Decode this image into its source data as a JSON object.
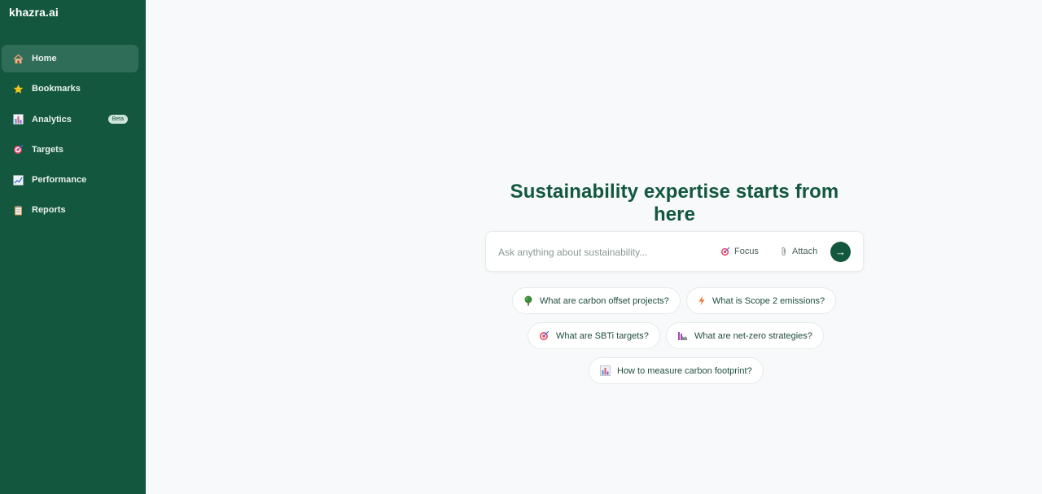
{
  "brand": "khazra.ai",
  "sidebar": {
    "items": [
      {
        "label": "Home",
        "icon": "home-icon"
      },
      {
        "label": "Bookmarks",
        "icon": "star-icon"
      },
      {
        "label": "Analytics",
        "icon": "bar-chart-icon",
        "badge": "Beta"
      },
      {
        "label": "Targets",
        "icon": "target-icon"
      },
      {
        "label": "Performance",
        "icon": "trend-chart-icon"
      },
      {
        "label": "Reports",
        "icon": "clipboard-icon"
      }
    ]
  },
  "main": {
    "headline": "Sustainability expertise starts from here",
    "search": {
      "placeholder": "Ask anything about sustainability...",
      "focus_label": "Focus",
      "attach_label": "Attach",
      "send_label": "→"
    },
    "suggestions": [
      {
        "label": "What are carbon offset projects?",
        "icon": "tree-icon"
      },
      {
        "label": "What is Scope 2 emissions?",
        "icon": "lightning-icon"
      },
      {
        "label": "What are SBTi targets?",
        "icon": "target-icon"
      },
      {
        "label": "What are net-zero strategies?",
        "icon": "factory-icon"
      },
      {
        "label": "How to measure carbon footprint?",
        "icon": "bar-chart-icon"
      }
    ]
  },
  "colors": {
    "sidebar_bg": "#13573f",
    "accent": "#13573f",
    "page_bg": "#f7f9fa"
  }
}
